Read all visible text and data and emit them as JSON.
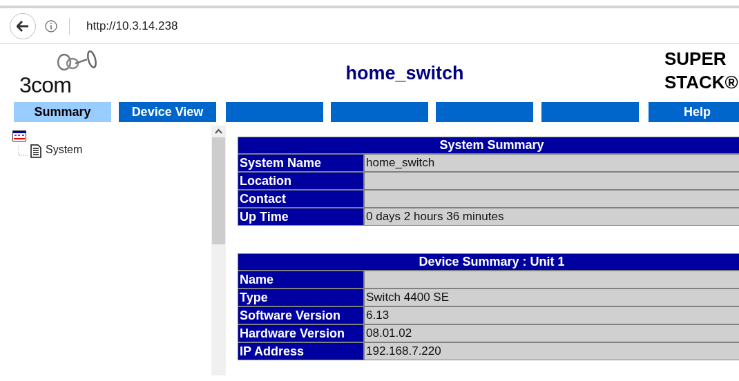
{
  "browser": {
    "url": "http://10.3.14.238"
  },
  "header": {
    "logo": "3com",
    "title": "home_switch",
    "brand_lines": [
      "SUPER",
      "STACK®"
    ]
  },
  "tabs": [
    {
      "label": "Summary",
      "selected": true
    },
    {
      "label": "Device View",
      "selected": false
    },
    {
      "selected": false
    },
    {
      "selected": false
    },
    {
      "selected": false
    },
    {
      "selected": false
    },
    {
      "label": "Help",
      "selected": false
    }
  ],
  "tree": {
    "children": [
      {
        "label": "System"
      }
    ]
  },
  "tables": [
    {
      "title": "System Summary",
      "rows": [
        {
          "label": "System Name",
          "value": "home_switch"
        },
        {
          "label": "Location"
        },
        {
          "label": "Contact"
        },
        {
          "label": "Up Time",
          "value": "0 days 2 hours 36 minutes"
        }
      ]
    },
    {
      "title": "Device Summary : Unit 1",
      "rows": [
        {
          "label": "Name"
        },
        {
          "label": "Type",
          "value": "Switch 4400 SE"
        },
        {
          "label": "Software Version",
          "value": "6.13"
        },
        {
          "label": "Hardware Version",
          "value": "08.01.02"
        },
        {
          "label": "IP Address",
          "value": "192.168.7.220"
        }
      ]
    }
  ]
}
